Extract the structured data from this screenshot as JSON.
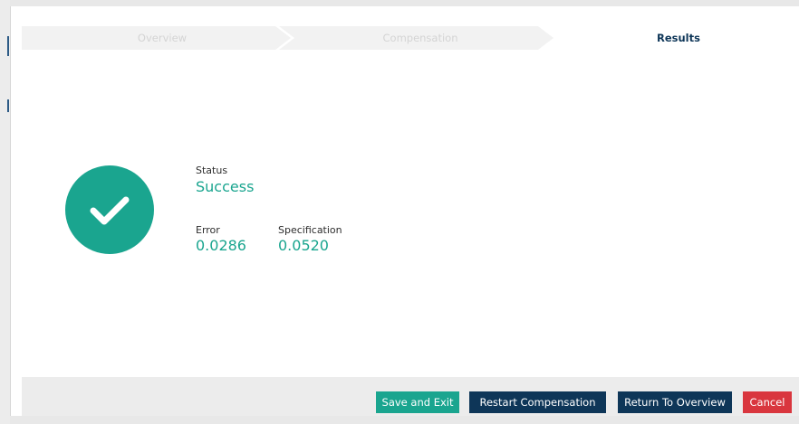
{
  "wizard": {
    "steps": [
      {
        "label": "Overview",
        "state": "inactive"
      },
      {
        "label": "Compensation",
        "state": "inactive"
      },
      {
        "label": "Results",
        "state": "active"
      }
    ]
  },
  "result": {
    "status_icon": "check-icon",
    "status_label": "Status",
    "status_value": "Success",
    "error_label": "Error",
    "error_value": "0.0286",
    "spec_label": "Specification",
    "spec_value": "0.0520"
  },
  "footer": {
    "save_exit": "Save and Exit",
    "restart": "Restart Compensation",
    "return_overview": "Return To Overview",
    "cancel": "Cancel"
  },
  "colors": {
    "accent": "#1aa58f",
    "primary": "#0e3658",
    "danger": "#d9363e"
  }
}
